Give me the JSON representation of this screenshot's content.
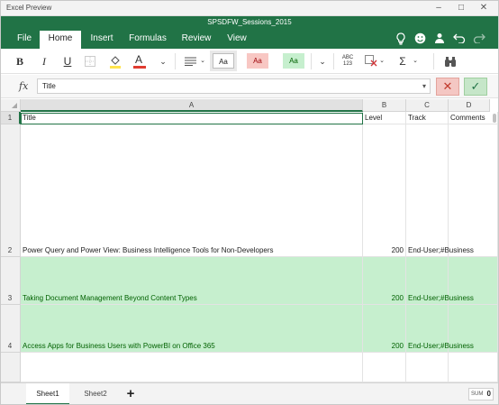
{
  "app": {
    "title": "Excel Preview"
  },
  "window_controls": {
    "minimize": "–",
    "maximize": "□",
    "close": "✕"
  },
  "document": {
    "title": "SPSDFW_Sessions_2015"
  },
  "ribbon": {
    "tabs": [
      {
        "label": "File"
      },
      {
        "label": "Home",
        "active": true
      },
      {
        "label": "Insert"
      },
      {
        "label": "Formulas"
      },
      {
        "label": "Review"
      },
      {
        "label": "View"
      }
    ],
    "icons": [
      "lightbulb-icon",
      "smiley-icon",
      "share-icon",
      "undo-icon",
      "redo-icon"
    ]
  },
  "toolbar": {
    "bold": "B",
    "italic": "I",
    "underline": "U",
    "font_color_letter": "A",
    "style_normal": "Aa",
    "style_bad": "Aa",
    "style_good": "Aa",
    "spelling": "ABC\n123",
    "autosum": "Σ"
  },
  "formula_bar": {
    "fx_label": "fx",
    "value": "Title",
    "caret": "▾",
    "cancel": "✕",
    "confirm": "✓"
  },
  "grid": {
    "columns": [
      {
        "label": "A",
        "selected": true
      },
      {
        "label": "B"
      },
      {
        "label": "C"
      },
      {
        "label": "D"
      }
    ],
    "rows": [
      {
        "row_number": "1",
        "cells": [
          "Title",
          "Level",
          "Track",
          "Comments"
        ],
        "highlight": false
      },
      {
        "row_number": "2",
        "cells": [
          "Power Query and Power View: Business Intelligence Tools for Non-Developers",
          "200",
          "End-User;#Business",
          ""
        ],
        "highlight": false
      },
      {
        "row_number": "3",
        "cells": [
          "Taking Document Management Beyond Content Types",
          "200",
          "End-User;#Business",
          ""
        ],
        "highlight": true
      },
      {
        "row_number": "4",
        "cells": [
          "Access Apps for Business Users with PowerBI on Office 365",
          "200",
          "End-User;#Business",
          ""
        ],
        "highlight": true
      }
    ],
    "selected_cell": "A1"
  },
  "sheets": {
    "tabs": [
      {
        "label": "Sheet1",
        "active": true
      },
      {
        "label": "Sheet2"
      }
    ],
    "add": "+"
  },
  "status": {
    "sum_label": "SUM",
    "sum_value": "0"
  },
  "colors": {
    "accent": "#217346",
    "highlight_fill": "#c6efce",
    "highlight_text": "#006100"
  }
}
